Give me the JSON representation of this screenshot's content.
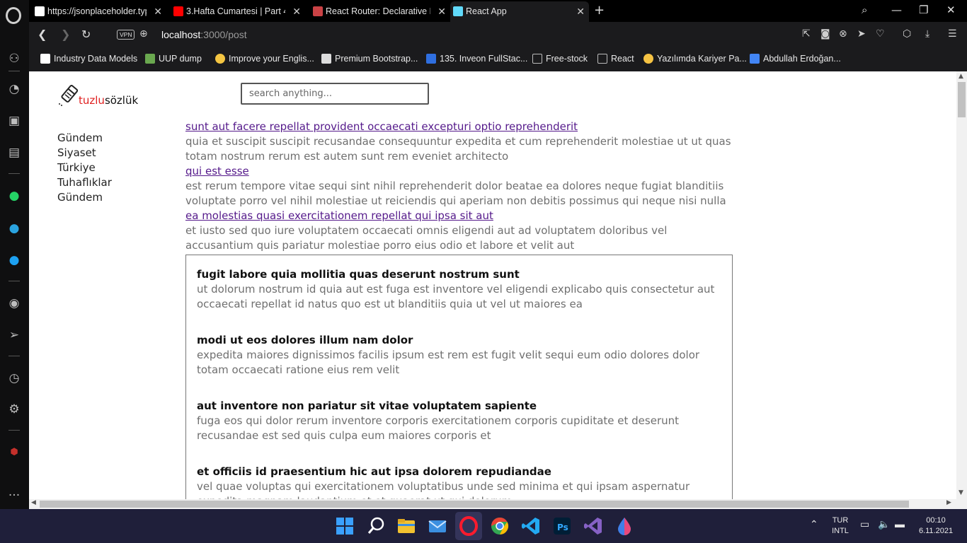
{
  "browser": {
    "tabs": [
      {
        "title": "https://jsonplaceholder.typ",
        "favicon_color": "#ffffff",
        "active": false
      },
      {
        "title": "3.Hafta Cumartesi | Part 4 (",
        "favicon_color": "#ff0000",
        "active": false
      },
      {
        "title": "React Router: Declarative R",
        "favicon_color": "#ca4245",
        "active": false
      },
      {
        "title": "React App",
        "favicon_color": "#61dafb",
        "active": true
      }
    ],
    "address": {
      "host": "localhost",
      "path": ":3000/post",
      "vpn_label": "VPN"
    },
    "bookmarks": [
      {
        "label": "Industry Data Models",
        "color": "#ffffff"
      },
      {
        "label": "UUP dump",
        "color": "#6aa84f"
      },
      {
        "label": "Improve your Englis...",
        "color": "#f4c542"
      },
      {
        "label": "Premium Bootstrap...",
        "color": "#dddddd"
      },
      {
        "label": "135. Inveon FullStac...",
        "color": "#2f6fe0"
      },
      {
        "label": "Free-stock",
        "color": "#bbbbbb"
      },
      {
        "label": "React",
        "color": "#bbbbbb"
      },
      {
        "label": "Yazılımda Kariyer Pa...",
        "color": "#f6c343"
      },
      {
        "label": "Abdullah Erdoğan...",
        "color": "#4285f4"
      }
    ]
  },
  "site": {
    "logo_red": "tuzlu",
    "logo_black": "sözlük",
    "search_placeholder": "search anything...",
    "menu": [
      "Gündem",
      "Siyaset",
      "Türkiye",
      "Tuhaflıklar",
      "Gündem"
    ]
  },
  "posts": [
    {
      "title": "sunt aut facere repellat provident occaecati excepturi optio reprehenderit",
      "body": "quia et suscipit suscipit recusandae consequuntur expedita et cum reprehenderit molestiae ut ut quas totam nostrum rerum est autem sunt rem eveniet architecto"
    },
    {
      "title": "qui est esse",
      "body": "est rerum tempore vitae sequi sint nihil reprehenderit dolor beatae ea dolores neque fugiat blanditiis voluptate porro vel nihil molestiae ut reiciendis qui aperiam non debitis possimus qui neque nisi nulla"
    },
    {
      "title": "ea molestias quasi exercitationem repellat qui ipsa sit aut",
      "body": "et iusto sed quo iure voluptatem occaecati omnis eligendi aut ad voluptatem doloribus vel accusantium quis pariatur molestiae porro eius odio et labore et velit aut"
    }
  ],
  "box_posts": [
    {
      "title": "fugit labore quia mollitia quas deserunt nostrum sunt",
      "body": "ut dolorum nostrum id quia aut est fuga est inventore vel eligendi explicabo quis consectetur aut occaecati repellat id natus quo est ut blanditiis quia ut vel ut maiores ea"
    },
    {
      "title": "modi ut eos dolores illum nam dolor",
      "body": "expedita maiores dignissimos facilis ipsum est rem est fugit velit sequi eum odio dolores dolor totam occaecati ratione eius rem velit"
    },
    {
      "title": "aut inventore non pariatur sit vitae voluptatem sapiente",
      "body": "fuga eos qui dolor rerum inventore corporis exercitationem corporis cupiditate et deserunt recusandae est sed quis culpa eum maiores corporis et"
    },
    {
      "title": "et officiis id praesentium hic aut ipsa dolorem repudiandae",
      "body": "vel quae voluptas qui exercitationem voluptatibus unde sed minima et qui ipsam aspernatur expedita magnam laudantium et et quaerat ut qui dolorum"
    }
  ],
  "taskbar": {
    "lang_top": "TUR",
    "lang_bottom": "INTL",
    "time": "00:10",
    "date": "6.11.2021",
    "apps": [
      {
        "name": "windows-start",
        "color": "#3aa0ff"
      },
      {
        "name": "search",
        "color": "#ffffff"
      },
      {
        "name": "file-explorer",
        "color": "#f2c230"
      },
      {
        "name": "mail",
        "color": "#3b8fe0"
      },
      {
        "name": "opera",
        "color": "#ff1b2d"
      },
      {
        "name": "chrome",
        "color": "#34a853"
      },
      {
        "name": "vscode",
        "color": "#23a9f2"
      },
      {
        "name": "photoshop",
        "color": "#31a8ff"
      },
      {
        "name": "visual-studio",
        "color": "#8661c5"
      },
      {
        "name": "paint",
        "color": "#3f7fe8"
      }
    ]
  }
}
